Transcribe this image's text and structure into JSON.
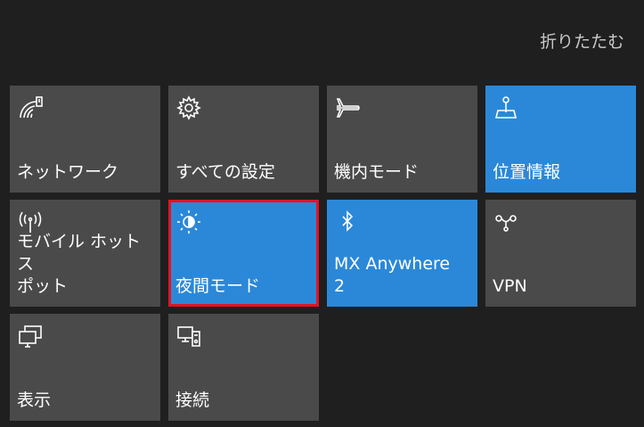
{
  "header": {
    "collapse_label": "折りたたむ"
  },
  "colors": {
    "active": "#2b88d8",
    "inactive": "#4a4a4a",
    "selected_border": "#e81123"
  },
  "tiles": [
    {
      "label": "ネットワーク",
      "icon": "wifi-icon",
      "active": false
    },
    {
      "label": "すべての設定",
      "icon": "gear-icon",
      "active": false
    },
    {
      "label": "機内モード",
      "icon": "airplane-icon",
      "active": false
    },
    {
      "label": "位置情報",
      "icon": "location-icon",
      "active": true
    },
    {
      "label": "モバイル ホットス\nポット",
      "icon": "hotspot-icon",
      "active": false
    },
    {
      "label": "夜間モード",
      "icon": "night-light-icon",
      "active": true,
      "selected": true
    },
    {
      "label": "MX Anywhere\n2",
      "icon": "bluetooth-icon",
      "active": true
    },
    {
      "label": "VPN",
      "icon": "vpn-icon",
      "active": false
    },
    {
      "label": "表示",
      "icon": "display-icon",
      "active": false
    },
    {
      "label": "接続",
      "icon": "connect-icon",
      "active": false
    }
  ]
}
